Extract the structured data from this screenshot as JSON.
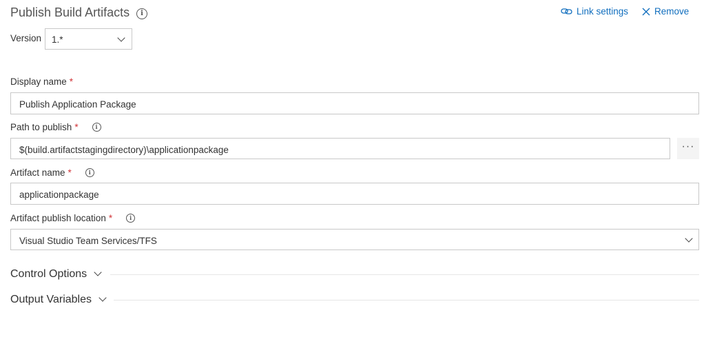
{
  "header": {
    "title": "Publish Build Artifacts",
    "link_settings": "Link settings",
    "remove": "Remove"
  },
  "version": {
    "label": "Version",
    "value": "1.*"
  },
  "fields": {
    "display_name": {
      "label": "Display name",
      "required": "*",
      "value": "Publish Application Package"
    },
    "path_to_publish": {
      "label": "Path to publish",
      "required": "*",
      "value": "$(build.artifactstagingdirectory)\\applicationpackage",
      "browse": "···"
    },
    "artifact_name": {
      "label": "Artifact name",
      "required": "*",
      "value": "applicationpackage"
    },
    "publish_location": {
      "label": "Artifact publish location",
      "required": "*",
      "value": "Visual Studio Team Services/TFS"
    }
  },
  "sections": {
    "control_options": "Control Options",
    "output_variables": "Output Variables"
  },
  "colors": {
    "link": "#106ebe",
    "required": "#d13438",
    "border": "#c8c8c8"
  }
}
